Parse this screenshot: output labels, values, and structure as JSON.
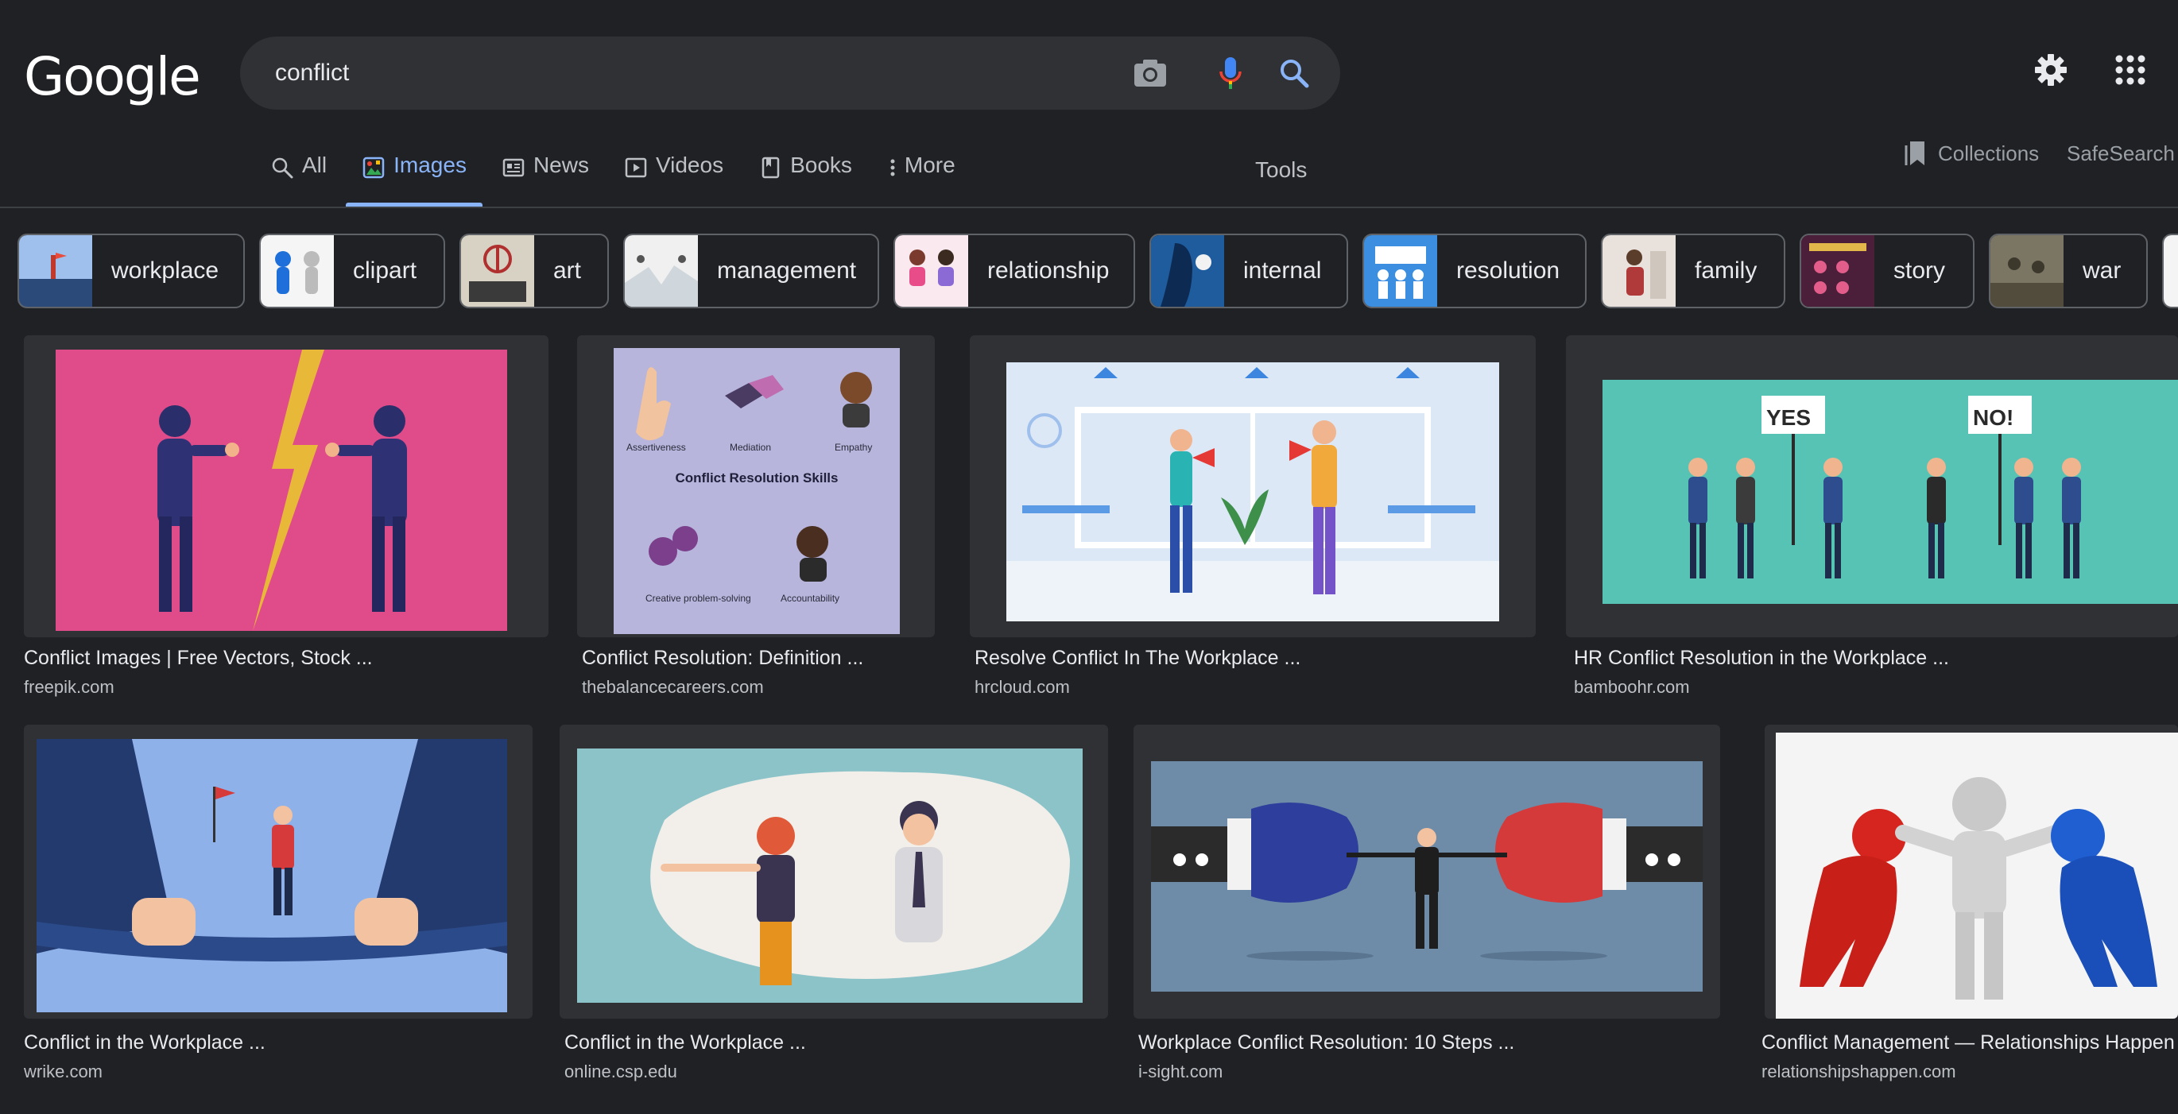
{
  "header": {
    "logo": "Google",
    "search": {
      "value": "conflict",
      "placeholder": ""
    },
    "icons": [
      "camera-icon",
      "microphone-icon",
      "search-icon",
      "gear-icon",
      "apps-grid-icon"
    ]
  },
  "tabs": [
    {
      "label": "All",
      "icon": "search-icon",
      "active": false
    },
    {
      "label": "Images",
      "icon": "image-icon",
      "active": true
    },
    {
      "label": "News",
      "icon": "news-icon",
      "active": false
    },
    {
      "label": "Videos",
      "icon": "video-icon",
      "active": false
    },
    {
      "label": "Books",
      "icon": "book-icon",
      "active": false
    },
    {
      "label": "More",
      "icon": "more-vert-icon",
      "active": false
    }
  ],
  "toolbar": {
    "tools": "Tools",
    "collections": "Collections",
    "safesearch": "SafeSearch"
  },
  "chips": [
    {
      "label": "workplace"
    },
    {
      "label": "clipart"
    },
    {
      "label": "art"
    },
    {
      "label": "management"
    },
    {
      "label": "relationship"
    },
    {
      "label": "internal"
    },
    {
      "label": "resolution"
    },
    {
      "label": "family"
    },
    {
      "label": "story"
    },
    {
      "label": "war"
    }
  ],
  "results": [
    {
      "title": "Conflict Images | Free Vectors, Stock ...",
      "source": "freepik.com"
    },
    {
      "title": "Conflict Resolution: Definition ...",
      "source": "thebalancecareers.com",
      "image_text": {
        "heading": "Conflict Resolution Skills",
        "skills": [
          "Assertiveness",
          "Mediation",
          "Empathy",
          "Creative problem-solving",
          "Accountability"
        ]
      }
    },
    {
      "title": "Resolve Conflict In The Workplace ...",
      "source": "hrcloud.com"
    },
    {
      "title": "HR Conflict Resolution in the Workplace ...",
      "source": "bamboohr.com",
      "image_text": {
        "sign_yes": "YES",
        "sign_no": "NO!"
      }
    },
    {
      "title": "Conflict in the Workplace ...",
      "source": "wrike.com"
    },
    {
      "title": "Conflict in the Workplace ...",
      "source": "online.csp.edu"
    },
    {
      "title": "Workplace Conflict Resolution: 10 Steps ...",
      "source": "i-sight.com"
    },
    {
      "title": "Conflict Management — Relationships Happen",
      "source": "relationshipshappen.com"
    }
  ],
  "colors": {
    "background": "#202124",
    "accent": "#8ab4f8",
    "surface": "#303134",
    "text": "#e8eaed",
    "muted": "#bdc1c6"
  }
}
